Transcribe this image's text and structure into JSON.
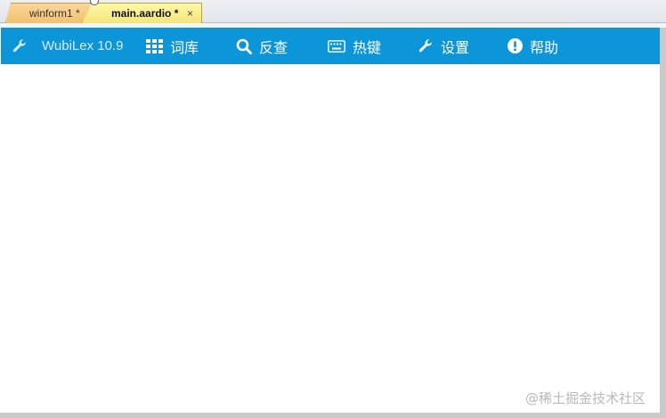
{
  "tabs": [
    {
      "label": "winform1 *",
      "active": false
    },
    {
      "label": "main.aardio *",
      "active": true
    }
  ],
  "tab_close_glyph": "×",
  "navbar": {
    "background": "#0c95d9",
    "brand": {
      "icon": "wrench-icon",
      "text": "WubiLex 10.9"
    },
    "items": [
      {
        "icon": "grid-icon",
        "label": "词库"
      },
      {
        "icon": "search-icon",
        "label": "反查"
      },
      {
        "icon": "keyboard-icon",
        "label": "热键"
      },
      {
        "icon": "wrench-icon",
        "label": "设置"
      },
      {
        "icon": "exclamation-circle-icon",
        "label": "帮助"
      }
    ]
  },
  "watermark": "@稀土掘金技术社区"
}
